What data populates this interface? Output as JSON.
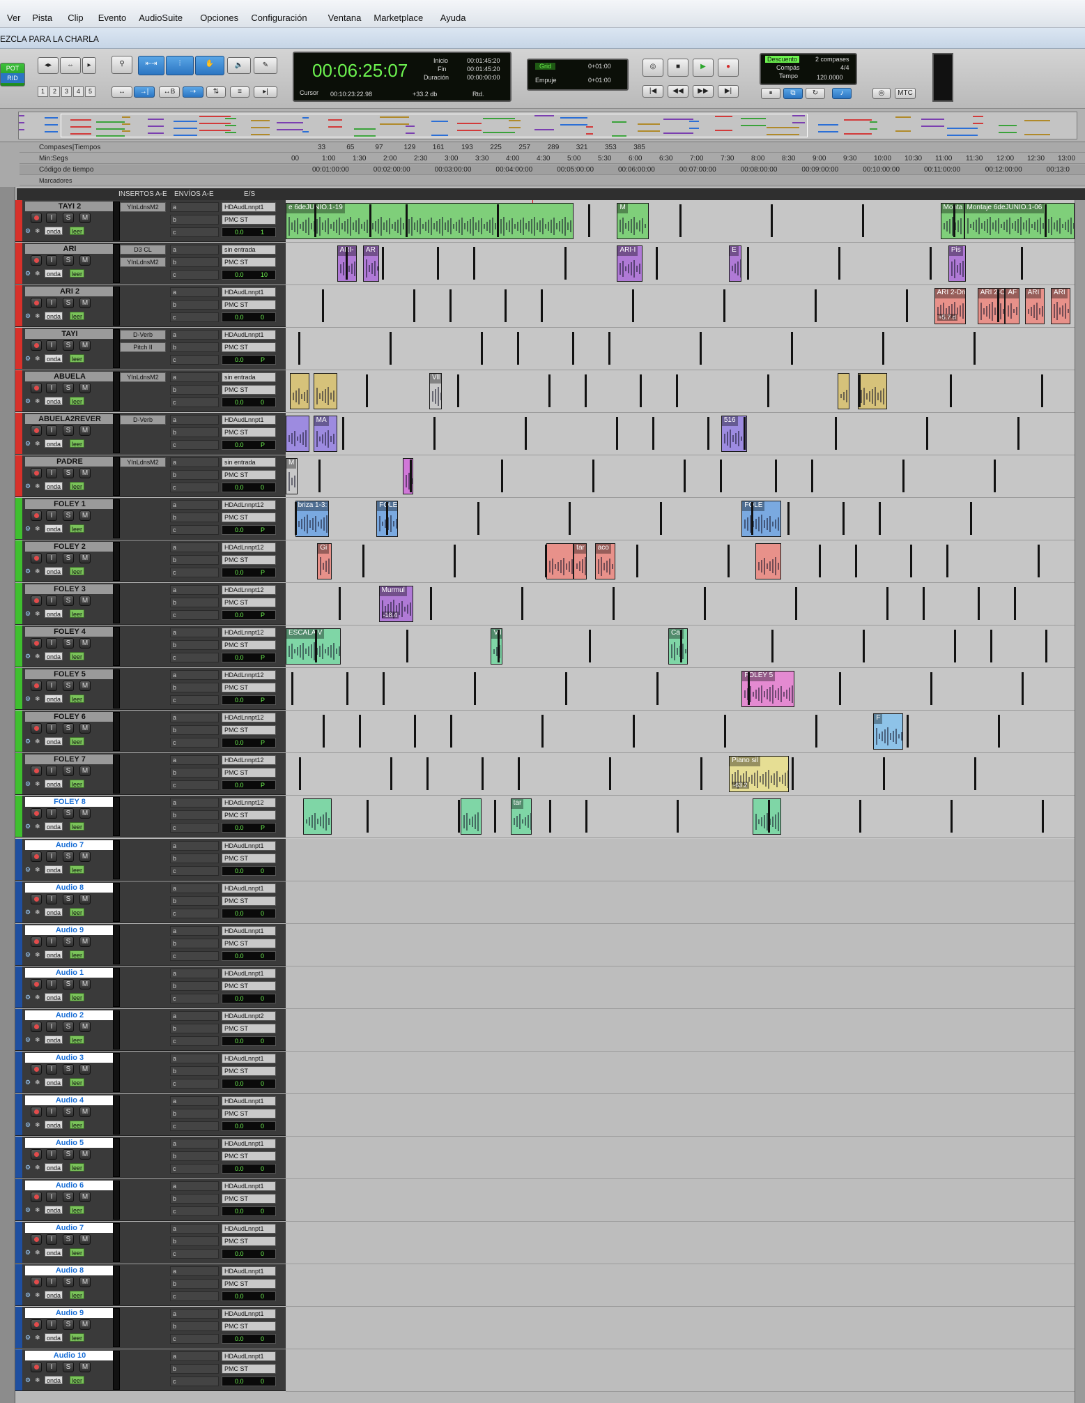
{
  "menu": [
    "Ver",
    "Pista",
    "Clip",
    "Evento",
    "AudioSuite",
    "Opciones",
    "Configuración",
    "Ventana",
    "Marketplace",
    "Ayuda"
  ],
  "window_title": "EZCLA PARA LA CHARLA",
  "toolbar": {
    "main_counter": "00:06:25:07",
    "inicio_label": "Inicio",
    "inicio": "00:01:45:20",
    "fin_label": "Fin",
    "fin": "00:01:45:20",
    "duracion_label": "Duración",
    "duracion": "00:00:00:00",
    "cursor_label": "Cursor",
    "cursor": "00:10:23:22.98",
    "level": "+33.2 db",
    "rtd": "Rtd.",
    "grid_label": "Grid",
    "grid_value": "0+01:00",
    "empuje_label": "Empuje",
    "empuje_value": "0+01:00",
    "descuento": "Descuento",
    "compases_count": "2 compases",
    "compas_label": "Compás",
    "compas": "4/4",
    "tempo_label": "Tempo",
    "tempo": "120.0000",
    "mtc": "MTC",
    "numbers": [
      "1",
      "2",
      "3",
      "4",
      "5"
    ],
    "left_badge_top": "POT",
    "left_badge_bottom": "RID"
  },
  "rulers": {
    "bars_label": "Compases|Tiempos",
    "minsec_label": "Min:Segs",
    "tc_label": "Código de tiempo",
    "markers_label": "Marcadores",
    "bars": [
      "33",
      "65",
      "97",
      "129",
      "161",
      "193",
      "225",
      "257",
      "289",
      "321",
      "353",
      "385"
    ],
    "minsec": [
      "00",
      "1:00",
      "1:30",
      "2:00",
      "2:30",
      "3:00",
      "3:30",
      "4:00",
      "4:30",
      "5:00",
      "5:30",
      "6:00",
      "6:30",
      "7:00",
      "7:30",
      "8:00",
      "8:30",
      "9:00",
      "9:30",
      "10:00",
      "10:30",
      "11:00",
      "11:30",
      "12:00",
      "12:30",
      "13:00"
    ],
    "timecode": [
      "00:01:00:00",
      "00:02:00:00",
      "00:03:00:00",
      "00:04:00:00",
      "00:05:00:00",
      "00:06:00:00",
      "00:07:00:00",
      "00:08:00:00",
      "00:09:00:00",
      "00:10:00:00",
      "00:11:00:00",
      "00:12:00:00",
      "00:13:0"
    ]
  },
  "columns": {
    "inserts": "INSERTOS A-E",
    "sends": "ENVÍOS A-E",
    "io": "E/S"
  },
  "track_buttons": {
    "rec": "",
    "input": "I",
    "solo": "S",
    "mute": "M",
    "onda": "onda",
    "leer": "leer"
  },
  "sends": [
    "a",
    "b",
    "c"
  ],
  "tracks": [
    {
      "name": "TAYI 2",
      "color": "#d8312a",
      "inserts": [
        "YInLdnsM2"
      ],
      "input": "HDAudLnnpt1",
      "output": "PMC ST",
      "vol": "0.0",
      "pan": "1"
    },
    {
      "name": "ARI",
      "color": "#d8312a",
      "inserts": [
        "D3 CL",
        "YInLdnsM2"
      ],
      "input": "sin entrada",
      "output": "PMC ST",
      "vol": "0.0",
      "pan": "10"
    },
    {
      "name": "ARI 2",
      "color": "#d8312a",
      "inserts": [],
      "input": "HDAudLnnpt1",
      "output": "PMC ST",
      "vol": "0.0",
      "pan": "0"
    },
    {
      "name": "TAYI",
      "color": "#d8312a",
      "inserts": [
        "D-Verb",
        "Pitch II"
      ],
      "input": "HDAudLnnpt1",
      "output": "PMC ST",
      "vol": "0.0",
      "pan": "P"
    },
    {
      "name": "ABUELA",
      "color": "#d8312a",
      "inserts": [
        "YInLdnsM2"
      ],
      "input": "sin entrada",
      "output": "PMC ST",
      "vol": "0.0",
      "pan": "0"
    },
    {
      "name": "ABUELA2REVER",
      "color": "#d8312a",
      "inserts": [
        "D-Verb"
      ],
      "input": "HDAudLnnpt1",
      "output": "PMC ST",
      "vol": "0.0",
      "pan": "P"
    },
    {
      "name": "PADRE",
      "color": "#d8312a",
      "inserts": [
        "YInLdnsM2"
      ],
      "input": "sin entrada",
      "output": "PMC ST",
      "vol": "0.0",
      "pan": "0"
    },
    {
      "name": "FOLEY 1",
      "color": "#3fbf2f",
      "inserts": [],
      "input": "HDAdLnnpt12",
      "output": "PMC ST",
      "vol": "0.0",
      "pan": "P"
    },
    {
      "name": "FOLEY 2",
      "color": "#3fbf2f",
      "inserts": [],
      "input": "HDAdLnnpt12",
      "output": "PMC ST",
      "vol": "0.0",
      "pan": "P"
    },
    {
      "name": "FOLEY 3",
      "color": "#3fbf2f",
      "inserts": [],
      "input": "HDAdLnnpt12",
      "output": "PMC ST",
      "vol": "0.0",
      "pan": "P"
    },
    {
      "name": "FOLEY 4",
      "color": "#3fbf2f",
      "inserts": [],
      "input": "HDAdLnnpt12",
      "output": "PMC ST",
      "vol": "0.0",
      "pan": "P"
    },
    {
      "name": "FOLEY 5",
      "color": "#3fbf2f",
      "inserts": [],
      "input": "HDAdLnnpt12",
      "output": "PMC ST",
      "vol": "0.0",
      "pan": "P"
    },
    {
      "name": "FOLEY 6",
      "color": "#3fbf2f",
      "inserts": [],
      "input": "HDAdLnnpt12",
      "output": "PMC ST",
      "vol": "0.0",
      "pan": "P"
    },
    {
      "name": "FOLEY 7",
      "color": "#3fbf2f",
      "inserts": [],
      "input": "HDAdLnnpt12",
      "output": "PMC ST",
      "vol": "0.0",
      "pan": "P"
    },
    {
      "name": "FOLEY 8",
      "color": "#3fbf2f",
      "inserts": [],
      "input": "HDAdLnnpt12",
      "output": "PMC ST",
      "vol": "0.0",
      "pan": "P"
    },
    {
      "name": "Audio 7",
      "color": "#1f4fa0",
      "inserts": [],
      "input": "HDAudLnnpt1",
      "output": "PMC ST",
      "vol": "0.0",
      "pan": "0"
    },
    {
      "name": "Audio 8",
      "color": "#1f4fa0",
      "inserts": [],
      "input": "HDAudLnnpt1",
      "output": "PMC ST",
      "vol": "0.0",
      "pan": "0"
    },
    {
      "name": "Audio 9",
      "color": "#1f4fa0",
      "inserts": [],
      "input": "HDAudLnnpt1",
      "output": "PMC ST",
      "vol": "0.0",
      "pan": "0"
    },
    {
      "name": "Audio 1",
      "color": "#1f4fa0",
      "inserts": [],
      "input": "HDAudLnnpt1",
      "output": "PMC ST",
      "vol": "0.0",
      "pan": "0"
    },
    {
      "name": "Audio 2",
      "color": "#1f4fa0",
      "inserts": [],
      "input": "HDAudLnnpt2",
      "output": "PMC ST",
      "vol": "0.0",
      "pan": "0"
    },
    {
      "name": "Audio 3",
      "color": "#1f4fa0",
      "inserts": [],
      "input": "HDAudLnnpt1",
      "output": "PMC ST",
      "vol": "0.0",
      "pan": "0"
    },
    {
      "name": "Audio 4",
      "color": "#1f4fa0",
      "inserts": [],
      "input": "HDAudLnnpt1",
      "output": "PMC ST",
      "vol": "0.0",
      "pan": "0"
    },
    {
      "name": "Audio 5",
      "color": "#1f4fa0",
      "inserts": [],
      "input": "HDAudLnnpt1",
      "output": "PMC ST",
      "vol": "0.0",
      "pan": "0"
    },
    {
      "name": "Audio 6",
      "color": "#1f4fa0",
      "inserts": [],
      "input": "HDAudLnnpt1",
      "output": "PMC ST",
      "vol": "0.0",
      "pan": "0"
    },
    {
      "name": "Audio 7",
      "color": "#1f4fa0",
      "inserts": [],
      "input": "HDAudLnnpt1",
      "output": "PMC ST",
      "vol": "0.0",
      "pan": "0"
    },
    {
      "name": "Audio 8",
      "color": "#1f4fa0",
      "inserts": [],
      "input": "HDAudLnnpt1",
      "output": "PMC ST",
      "vol": "0.0",
      "pan": "0"
    },
    {
      "name": "Audio 9",
      "color": "#1f4fa0",
      "inserts": [],
      "input": "HDAudLnnpt1",
      "output": "PMC ST",
      "vol": "0.0",
      "pan": "0"
    },
    {
      "name": "Audio 10",
      "color": "#1f4fa0",
      "inserts": [],
      "input": "HDAudLnnpt1",
      "output": "PMC ST",
      "vol": "0.0",
      "pan": "0"
    }
  ],
  "clips": [
    {
      "track": 0,
      "start": 0.0,
      "end": 0.365,
      "color": "#7fcf7a",
      "name": "e 6deJUNIO.1-19"
    },
    {
      "track": 0,
      "start": 0.42,
      "end": 0.46,
      "color": "#7fcf7a",
      "name": "M"
    },
    {
      "track": 0,
      "start": 0.83,
      "end": 0.86,
      "color": "#7fcf7a",
      "name": "Monta"
    },
    {
      "track": 0,
      "start": 0.86,
      "end": 1.0,
      "color": "#7fcf7a",
      "name": "Montaje 6deJUNIO.1-06"
    },
    {
      "track": 1,
      "start": 0.065,
      "end": 0.09,
      "color": "#b07ad6",
      "name": "ARI-"
    },
    {
      "track": 1,
      "start": 0.098,
      "end": 0.118,
      "color": "#b07ad6",
      "name": "AR"
    },
    {
      "track": 1,
      "start": 0.42,
      "end": 0.452,
      "color": "#b07ad6",
      "name": "ARI-I"
    },
    {
      "track": 1,
      "start": 0.562,
      "end": 0.578,
      "color": "#b07ad6",
      "name": "E"
    },
    {
      "track": 1,
      "start": 0.84,
      "end": 0.862,
      "color": "#b07ad6",
      "name": "Pis"
    },
    {
      "track": 2,
      "start": 0.822,
      "end": 0.862,
      "color": "#e8918a",
      "name": "ARI 2-Dnc"
    },
    {
      "track": 2,
      "start": 0.877,
      "end": 0.912,
      "color": "#e8918a",
      "name": "ARI 2-C"
    },
    {
      "track": 2,
      "start": 0.912,
      "end": 0.93,
      "color": "#e8918a",
      "name": "AF"
    },
    {
      "track": 2,
      "start": 0.937,
      "end": 0.962,
      "color": "#e8918a",
      "name": "ARI"
    },
    {
      "track": 2,
      "start": 0.97,
      "end": 0.995,
      "color": "#e8918a",
      "name": "ARI"
    },
    {
      "track": 4,
      "start": 0.005,
      "end": 0.03,
      "color": "#d6c27a",
      "name": ""
    },
    {
      "track": 4,
      "start": 0.035,
      "end": 0.065,
      "color": "#d6c27a",
      "name": ""
    },
    {
      "track": 4,
      "start": 0.182,
      "end": 0.198,
      "color": "#c8c8c8",
      "name": "Vll"
    },
    {
      "track": 4,
      "start": 0.7,
      "end": 0.715,
      "color": "#d6c27a",
      "name": ""
    },
    {
      "track": 4,
      "start": 0.725,
      "end": 0.762,
      "color": "#d6c27a",
      "name": ""
    },
    {
      "track": 5,
      "start": 0.0,
      "end": 0.03,
      "color": "#9d8be0",
      "name": ""
    },
    {
      "track": 5,
      "start": 0.035,
      "end": 0.065,
      "color": "#9d8be0",
      "name": "MA"
    },
    {
      "track": 5,
      "start": 0.552,
      "end": 0.585,
      "color": "#9d8be0",
      "name": "516"
    },
    {
      "track": 6,
      "start": 0.0,
      "end": 0.015,
      "color": "#c8c8c8",
      "name": "M"
    },
    {
      "track": 6,
      "start": 0.148,
      "end": 0.162,
      "color": "#d078d8",
      "name": ""
    },
    {
      "track": 7,
      "start": 0.012,
      "end": 0.055,
      "color": "#7aa9e0",
      "name": "briza 1-3:"
    },
    {
      "track": 7,
      "start": 0.115,
      "end": 0.142,
      "color": "#7aa9e0",
      "name": "FOLE"
    },
    {
      "track": 7,
      "start": 0.578,
      "end": 0.628,
      "color": "#7aa9e0",
      "name": "FOLE"
    },
    {
      "track": 8,
      "start": 0.04,
      "end": 0.058,
      "color": "#e8918a",
      "name": "Gi"
    },
    {
      "track": 8,
      "start": 0.33,
      "end": 0.365,
      "color": "#e8918a",
      "name": ""
    },
    {
      "track": 8,
      "start": 0.365,
      "end": 0.382,
      "color": "#e8918a",
      "name": "tar"
    },
    {
      "track": 8,
      "start": 0.392,
      "end": 0.418,
      "color": "#e8918a",
      "name": "aco"
    },
    {
      "track": 8,
      "start": 0.595,
      "end": 0.628,
      "color": "#e8918a",
      "name": ""
    },
    {
      "track": 9,
      "start": 0.118,
      "end": 0.162,
      "color": "#b07ad6",
      "name": "Murmul"
    },
    {
      "track": 10,
      "start": 0.0,
      "end": 0.07,
      "color": "#7fd6a6",
      "name": "ESCALA V"
    },
    {
      "track": 10,
      "start": 0.26,
      "end": 0.275,
      "color": "#7fd6a6",
      "name": "Vll"
    },
    {
      "track": 10,
      "start": 0.485,
      "end": 0.51,
      "color": "#7fd6a6",
      "name": "Cal"
    },
    {
      "track": 11,
      "start": 0.578,
      "end": 0.645,
      "color": "#e48ad1",
      "name": "FOLEY 5"
    },
    {
      "track": 12,
      "start": 0.745,
      "end": 0.783,
      "color": "#8ec3e8",
      "name": "F"
    },
    {
      "track": 13,
      "start": 0.562,
      "end": 0.638,
      "color": "#e6de94",
      "name": "Piano sil"
    },
    {
      "track": 14,
      "start": 0.022,
      "end": 0.058,
      "color": "#7fd6a6",
      "name": ""
    },
    {
      "track": 14,
      "start": 0.222,
      "end": 0.248,
      "color": "#7fd6a6",
      "name": ""
    },
    {
      "track": 14,
      "start": 0.285,
      "end": 0.312,
      "color": "#7fd6a6",
      "name": "tar"
    },
    {
      "track": 14,
      "start": 0.592,
      "end": 0.628,
      "color": "#7fd6a6",
      "name": ""
    }
  ],
  "clip_gain_labels": [
    {
      "track": 9,
      "text": "-18.4"
    },
    {
      "track": 13,
      "text": "-63.2"
    },
    {
      "track": 2,
      "text": "+5.7 d"
    }
  ]
}
